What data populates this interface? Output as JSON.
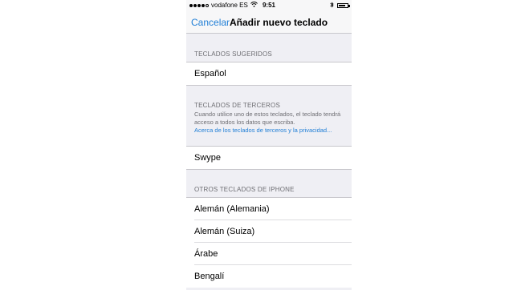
{
  "status_bar": {
    "carrier": "vodafone ES",
    "time": "9:51",
    "signal_bars": 4,
    "battery_level": 0.8
  },
  "nav": {
    "cancel_label": "Cancelar",
    "title": "Añadir nuevo teclado"
  },
  "suggested": {
    "header": "TECLADOS SUGERIDOS",
    "items": [
      "Español"
    ]
  },
  "third_party": {
    "header": "TECLADOS DE TERCEROS",
    "description": "Cuando utilice uno de estos teclados, el teclado tendrá acceso a todos los datos que escriba.",
    "link": "Acerca de los teclados de terceros y la privacidad...",
    "items": [
      "Swype"
    ]
  },
  "other": {
    "header": "OTROS TECLADOS DE IPHONE",
    "items": [
      "Alemán (Alemania)",
      "Alemán (Suiza)",
      "Árabe",
      "Bengalí"
    ]
  }
}
